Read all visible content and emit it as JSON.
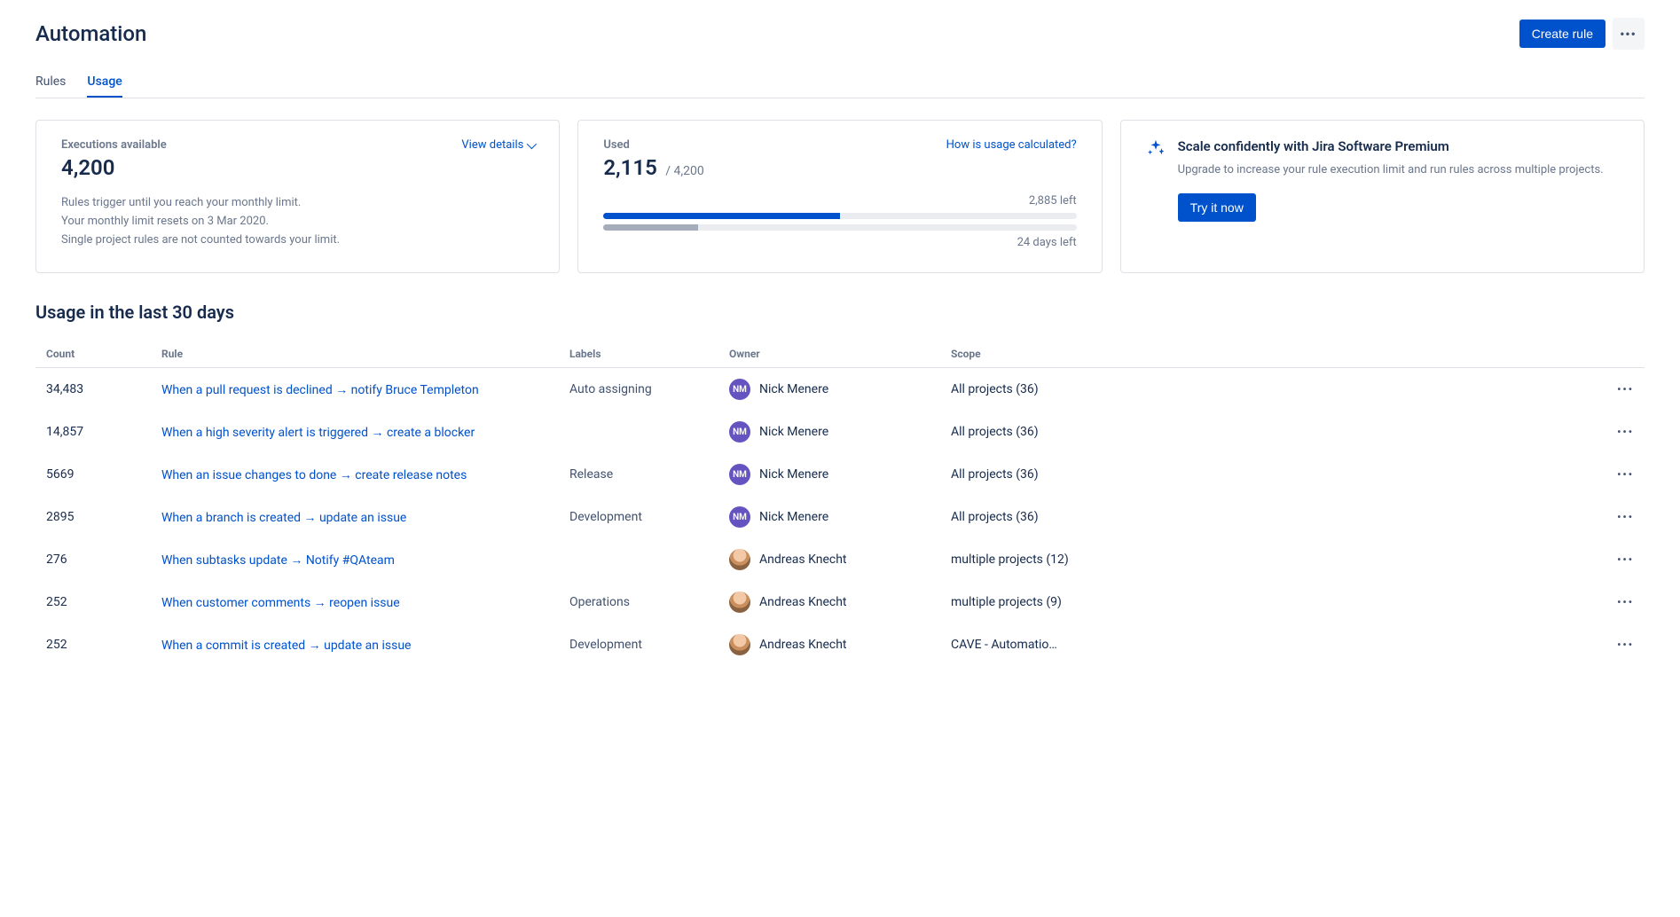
{
  "header": {
    "title": "Automation",
    "create_rule": "Create rule"
  },
  "tabs": {
    "rules": "Rules",
    "usage": "Usage"
  },
  "card_executions": {
    "label": "Executions available",
    "view_details": "View details",
    "value": "4,200",
    "desc_line1": "Rules trigger until you reach your monthly limit.",
    "desc_line2": "Your monthly limit resets on 3 Mar 2020.",
    "desc_line3": "Single project rules are not counted towards your limit."
  },
  "card_used": {
    "label": "Used",
    "how_link": "How is usage calculated?",
    "value": "2,115",
    "of": "/ 4,200",
    "left": "2,885 left",
    "days_left": "24 days left",
    "progress_pct": 50,
    "days_pct": 20
  },
  "card_promo": {
    "title": "Scale confidently with Jira Software Premium",
    "desc": "Upgrade to increase your rule execution limit and run rules across multiple projects.",
    "cta": "Try it now"
  },
  "section_title": "Usage in the last 30 days",
  "table": {
    "headers": {
      "count": "Count",
      "rule": "Rule",
      "labels": "Labels",
      "owner": "Owner",
      "scope": "Scope"
    },
    "rows": [
      {
        "count": "34,483",
        "rule": "When a pull request is declined → notify Bruce Templeton",
        "labels": "Auto assigning",
        "owner": "Nick Menere",
        "owner_initials": "NM",
        "owner_type": "nm",
        "scope": "All projects (36)"
      },
      {
        "count": "14,857",
        "rule": "When a high severity alert is triggered → create a blocker",
        "labels": "",
        "owner": "Nick Menere",
        "owner_initials": "NM",
        "owner_type": "nm",
        "scope": "All projects (36)"
      },
      {
        "count": "5669",
        "rule": "When an issue changes to done → create release notes",
        "labels": "Release",
        "owner": "Nick Menere",
        "owner_initials": "NM",
        "owner_type": "nm",
        "scope": "All projects (36)"
      },
      {
        "count": "2895",
        "rule": "When a branch is created → update an issue",
        "labels": "Development",
        "owner": "Nick Menere",
        "owner_initials": "NM",
        "owner_type": "nm",
        "scope": "All projects (36)"
      },
      {
        "count": "276",
        "rule": "When subtasks update  → Notify #QAteam",
        "labels": "",
        "owner": "Andreas Knecht",
        "owner_initials": "",
        "owner_type": "ak",
        "scope": "multiple projects (12)"
      },
      {
        "count": "252",
        "rule": "When customer comments  →  reopen issue",
        "labels": "Operations",
        "owner": "Andreas Knecht",
        "owner_initials": "",
        "owner_type": "ak",
        "scope": "multiple projects (9)"
      },
      {
        "count": "252",
        "rule": "When a commit is created → update an issue",
        "labels": "Development",
        "owner": "Andreas Knecht",
        "owner_initials": "",
        "owner_type": "ak",
        "scope": "CAVE - Automatio…"
      }
    ]
  }
}
